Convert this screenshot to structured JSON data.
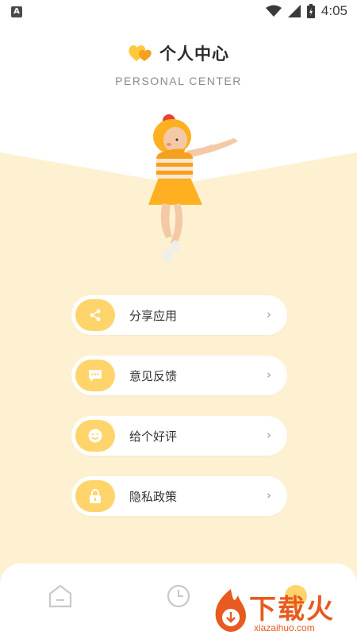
{
  "status_bar": {
    "time": "4:05",
    "notification_icon": "a-icon"
  },
  "header": {
    "title": "个人中心",
    "subtitle": "PERSONAL CENTER"
  },
  "menu": [
    {
      "label": "分享应用",
      "icon": "share-icon"
    },
    {
      "label": "意见反馈",
      "icon": "message-icon"
    },
    {
      "label": "给个好评",
      "icon": "smile-icon"
    },
    {
      "label": "隐私政策",
      "icon": "lock-icon"
    }
  ],
  "bottom_nav": [
    {
      "icon": "home-icon"
    },
    {
      "icon": "clock-icon"
    },
    {
      "icon": "profile-icon"
    }
  ],
  "watermark": {
    "text": "下载火",
    "sub": "xiazaihuo.com"
  },
  "colors": {
    "accent": "#ffd46b",
    "cream": "#fdf1d2",
    "brand": "#e85a1f"
  }
}
